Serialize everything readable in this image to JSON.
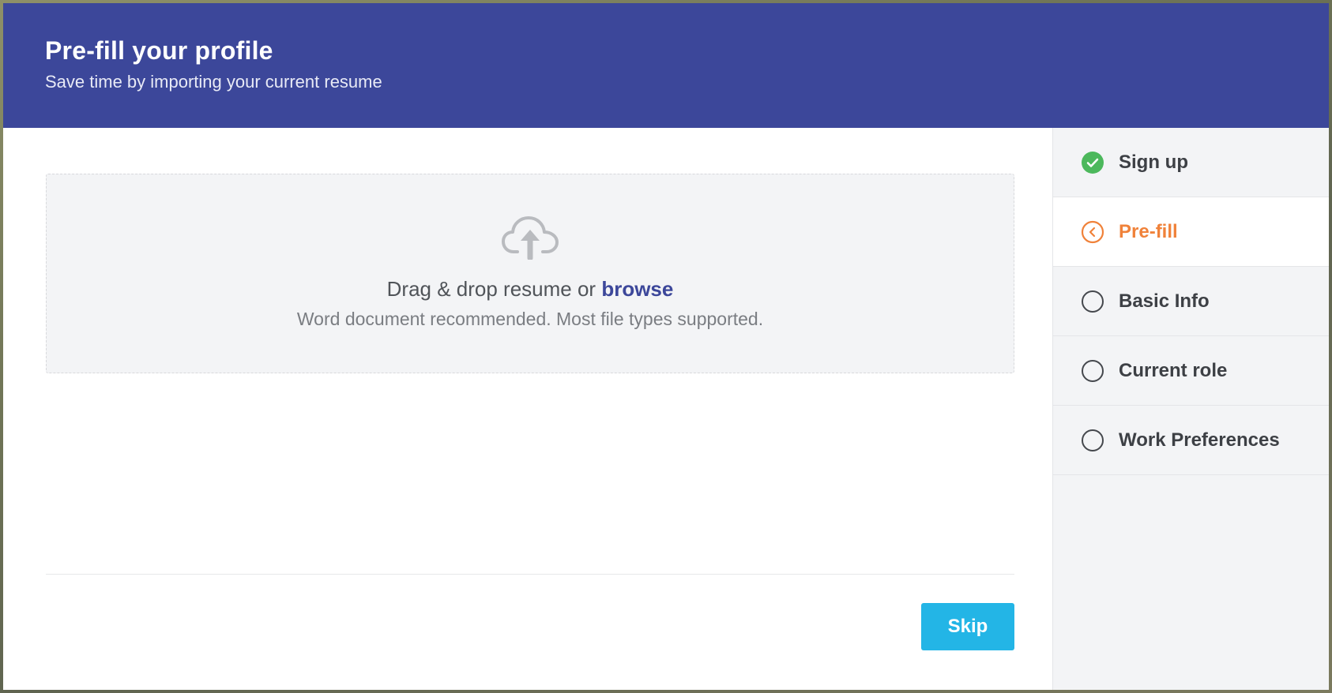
{
  "header": {
    "title": "Pre-fill your profile",
    "subtitle": "Save time by importing your current resume"
  },
  "dropzone": {
    "icon": "cloud-upload-icon",
    "prompt_text": "Drag & drop resume or ",
    "browse_label": "browse",
    "hint": "Word document recommended. Most file types supported."
  },
  "footer": {
    "skip_label": "Skip"
  },
  "steps": [
    {
      "label": "Sign up",
      "status": "complete",
      "icon": "check-circle-icon"
    },
    {
      "label": "Pre-fill",
      "status": "current",
      "icon": "chevron-left-circle-icon"
    },
    {
      "label": "Basic Info",
      "status": "pending",
      "icon": "empty-circle-icon"
    },
    {
      "label": "Current role",
      "status": "pending",
      "icon": "empty-circle-icon"
    },
    {
      "label": "Work Preferences",
      "status": "pending",
      "icon": "empty-circle-icon"
    }
  ],
  "colors": {
    "header_bg": "#3c479a",
    "accent_orange": "#f0823a",
    "success_green": "#4cb85c",
    "skip_button": "#23b5e6",
    "link": "#3c479a"
  }
}
